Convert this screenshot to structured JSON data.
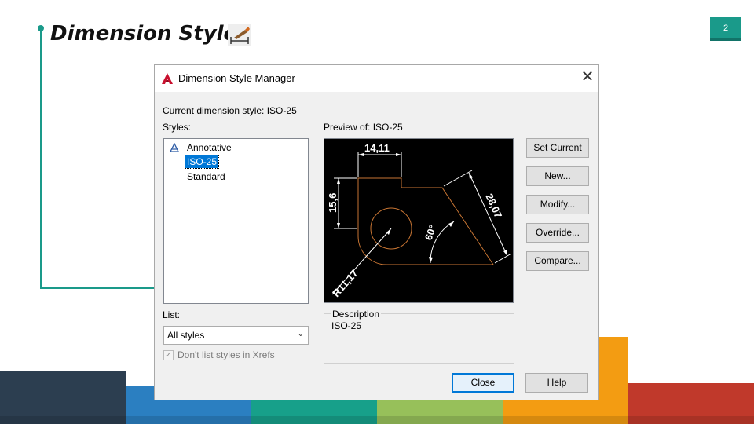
{
  "slide": {
    "title": "Dimension Style",
    "page_number": "2",
    "title_icon": "dimension-style-icon",
    "colors": {
      "accent": "#1a9a8a",
      "stripes": [
        "#2c3e50",
        "#2b7fc1",
        "#17a08a",
        "#97c05a",
        "#f39c12",
        "#c0392b"
      ]
    }
  },
  "dialog": {
    "title": "Dimension Style Manager",
    "current_style": "Current dimension style: ISO-25",
    "styles_label": "Styles:",
    "styles": [
      {
        "label": "Annotative",
        "icon": "annotative-icon"
      },
      {
        "label": "ISO-25",
        "selected": true
      },
      {
        "label": "Standard"
      }
    ],
    "preview_label": "Preview of: ISO-25",
    "preview": {
      "dim_horizontal": "14,11",
      "dim_vertical": "15,6",
      "dim_aligned": "28,07",
      "dim_angle": "60°",
      "dim_radius": "R11,17"
    },
    "buttons": {
      "set_current": "Set Current",
      "new": "New...",
      "modify": "Modify...",
      "override": "Override...",
      "compare": "Compare...",
      "close": "Close",
      "help": "Help"
    },
    "list_label": "List:",
    "list_value": "All styles",
    "xrefs_checkbox": {
      "label": "Don't list styles in Xrefs",
      "checked": true,
      "disabled": true
    },
    "description_label": "Description",
    "description_value": "ISO-25"
  }
}
